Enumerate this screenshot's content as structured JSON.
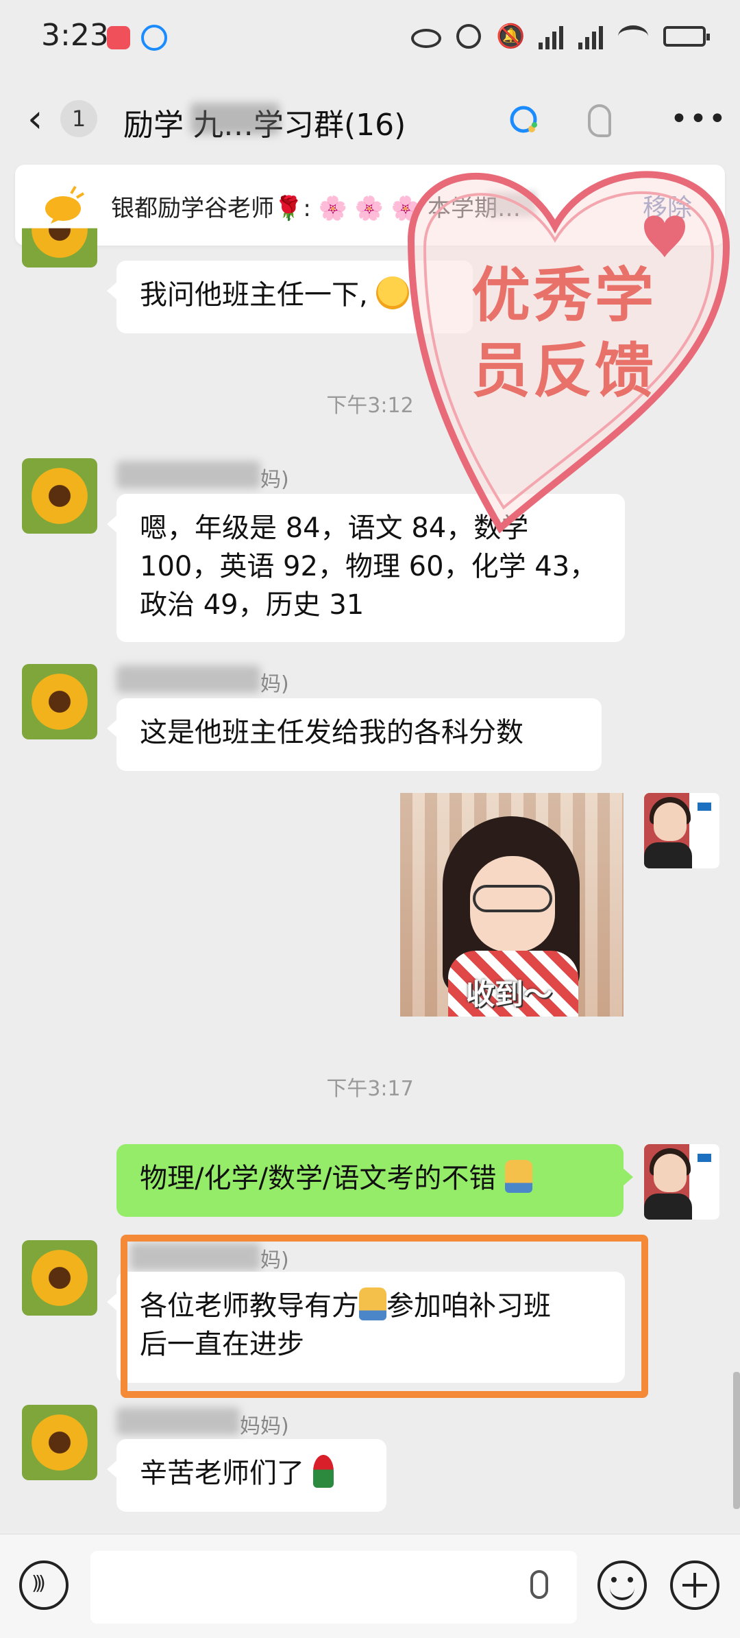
{
  "status_bar": {
    "time": "3:23",
    "icons": [
      "app-red-icon",
      "qq-browser-icon",
      "eye-icon",
      "alarm-icon",
      "mute-icon",
      "5g-signal-icon",
      "5g-signal-icon",
      "wifi-icon",
      "battery-icon"
    ]
  },
  "header": {
    "back_badge": "1",
    "title": "励学      九…学习群(16)",
    "icons": [
      "back-icon",
      "qq-icon",
      "ear-icon",
      "more-icon"
    ]
  },
  "notice": {
    "text": "银都励学谷老师🌹: 🌸 🌸 🌸      本学期…",
    "remove_label": "移除"
  },
  "overlay": {
    "line1": "优秀学",
    "line2": "员反馈",
    "heart_color": "#e8716a"
  },
  "messages": [
    {
      "text": "我问他班主任一下,"
    },
    {
      "timestamp": "下午3:12"
    },
    {
      "name_suffix": "妈)",
      "text_lines": [
        "嗯，年级是 84，语文 84，数学",
        "100，英语 92，物理 60，化学 43，",
        "政治 49，历史 31"
      ]
    },
    {
      "name_suffix": "妈)",
      "text": "这是他班主任发给我的各科分数"
    },
    {
      "sticker_caption": "收到～"
    },
    {
      "timestamp": "下午3:17"
    },
    {
      "text": "物理/化学/数学/语文考的不错"
    },
    {
      "name_suffix": "妈)",
      "text_lines": [
        "各位老师教导有方",
        "参加咱补习班",
        "后一直在进步"
      ]
    },
    {
      "name_suffix": "妈妈)",
      "text": "辛苦老师们了"
    }
  ],
  "colors": {
    "background": "#ededed",
    "my_bubble": "#95ec69",
    "highlight_border": "#f48a38"
  }
}
